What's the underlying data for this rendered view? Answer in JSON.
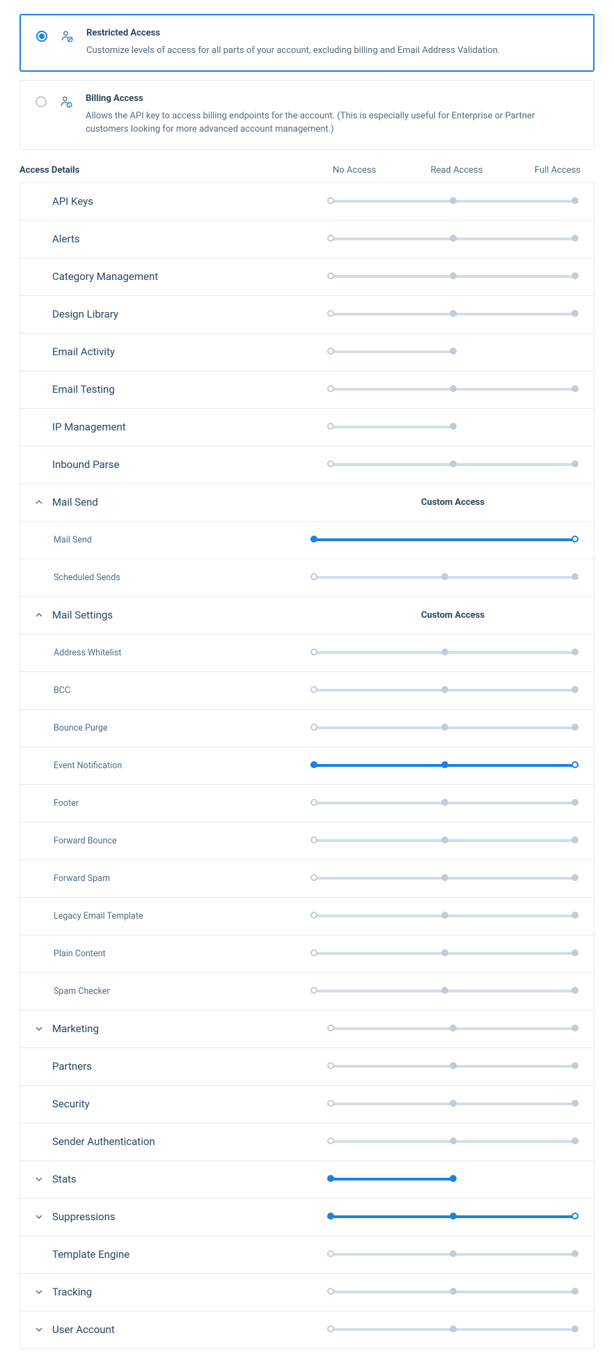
{
  "options": {
    "restricted": {
      "title": "Restricted Access",
      "desc": "Customize levels of access for all parts of your account, excluding billing and Email Address Validation."
    },
    "billing": {
      "title": "Billing Access",
      "desc": "Allows the API key to access billing endpoints for the account. (This is especially useful for Enterprise or Partner customers looking for more advanced account management.)"
    }
  },
  "header": {
    "title": "Access Details",
    "cols": [
      "No Access",
      "Read Access",
      "Full Access"
    ]
  },
  "custom_label": "Custom Access",
  "rows": [
    {
      "label": "API Keys",
      "type": "slider3",
      "value": 1
    },
    {
      "label": "Alerts",
      "type": "slider3",
      "value": 1
    },
    {
      "label": "Category Management",
      "type": "slider3",
      "value": 1
    },
    {
      "label": "Design Library",
      "type": "slider3",
      "value": 1
    },
    {
      "label": "Email Activity",
      "type": "slider2",
      "value": 1
    },
    {
      "label": "Email Testing",
      "type": "slider3",
      "value": 1
    },
    {
      "label": "IP Management",
      "type": "slider2",
      "value": 1
    },
    {
      "label": "Inbound Parse",
      "type": "slider3",
      "value": 1
    },
    {
      "label": "Mail Send",
      "type": "group",
      "expanded": true,
      "custom": true,
      "children": [
        {
          "label": "Mail Send",
          "type": "slider2-on",
          "value": 0
        },
        {
          "label": "Scheduled Sends",
          "type": "slider3",
          "value": 1
        }
      ]
    },
    {
      "label": "Mail Settings",
      "type": "group",
      "expanded": true,
      "custom": true,
      "children": [
        {
          "label": "Address Whitelist",
          "type": "slider3",
          "value": 1
        },
        {
          "label": "BCC",
          "type": "slider3",
          "value": 1
        },
        {
          "label": "Bounce Purge",
          "type": "slider3",
          "value": 1
        },
        {
          "label": "Event Notification",
          "type": "slider3-on",
          "value": 1
        },
        {
          "label": "Footer",
          "type": "slider3",
          "value": 1
        },
        {
          "label": "Forward Bounce",
          "type": "slider3",
          "value": 1
        },
        {
          "label": "Forward Spam",
          "type": "slider3",
          "value": 1
        },
        {
          "label": "Legacy Email Template",
          "type": "slider3",
          "value": 1
        },
        {
          "label": "Plain Content",
          "type": "slider3",
          "value": 1
        },
        {
          "label": "Spam Checker",
          "type": "slider3",
          "value": 1
        }
      ]
    },
    {
      "label": "Marketing",
      "type": "slider3",
      "value": 1,
      "expandable": true
    },
    {
      "label": "Partners",
      "type": "slider3",
      "value": 1
    },
    {
      "label": "Security",
      "type": "slider3",
      "value": 1
    },
    {
      "label": "Sender Authentication",
      "type": "slider3",
      "value": 1
    },
    {
      "label": "Stats",
      "type": "slider2-half-on",
      "value": 1,
      "expandable": true
    },
    {
      "label": "Suppressions",
      "type": "slider3-on",
      "value": 1,
      "expandable": true
    },
    {
      "label": "Template Engine",
      "type": "slider3",
      "value": 1
    },
    {
      "label": "Tracking",
      "type": "slider3",
      "value": 1,
      "expandable": true
    },
    {
      "label": "User Account",
      "type": "slider3",
      "value": 1,
      "expandable": true
    }
  ]
}
